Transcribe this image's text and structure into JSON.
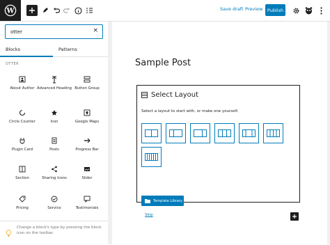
{
  "topbar": {
    "save_draft": "Save draft",
    "preview": "Preview",
    "publish": "Publish",
    "accent": "#007cba"
  },
  "sidebar": {
    "search_value": "otter",
    "tabs": [
      "Blocks",
      "Patterns"
    ],
    "active_tab": "Blocks",
    "group_label": "OTTER",
    "blocks": [
      {
        "label": "About Author",
        "icon": "author-icon"
      },
      {
        "label": "Advanced Heading",
        "icon": "heading-icon"
      },
      {
        "label": "Button Group",
        "icon": "button-group-icon"
      },
      {
        "label": "Circle Counter",
        "icon": "circle-counter-icon"
      },
      {
        "label": "Icon",
        "icon": "icon-icon"
      },
      {
        "label": "Google Maps",
        "icon": "map-icon"
      },
      {
        "label": "Plugin Card",
        "icon": "plugin-card-icon"
      },
      {
        "label": "Posts",
        "icon": "posts-icon"
      },
      {
        "label": "Progress Bar",
        "icon": "progress-bar-icon"
      },
      {
        "label": "Section",
        "icon": "section-icon"
      },
      {
        "label": "Sharing Icons",
        "icon": "share-icon"
      },
      {
        "label": "Slider",
        "icon": "slider-icon"
      },
      {
        "label": "Pricing",
        "icon": "pricing-icon"
      },
      {
        "label": "Service",
        "icon": "service-icon"
      },
      {
        "label": "Testimonials",
        "icon": "testimonials-icon"
      }
    ],
    "tip": "Change a block's type by pressing the block icon on the toolbar."
  },
  "editor": {
    "post_title": "Sample Post",
    "layout": {
      "title": "Select Layout",
      "instruction": "Select a layout to start with, or make one yourself.",
      "options": [
        "1/2 + 1/2",
        "1/3 + 2/3",
        "2/3 + 1/3",
        "1/3 x 3",
        "1/4 + 1/2 + 1/4",
        "1/4 x 4",
        "1/6 x 6"
      ],
      "template_button": "Template Library",
      "skip": "Skip"
    }
  }
}
